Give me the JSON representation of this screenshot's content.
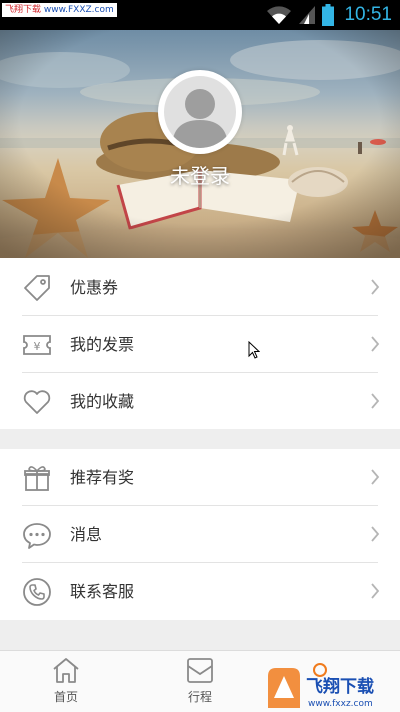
{
  "status_bar": {
    "watermark_label": "飞翔下载",
    "watermark_url": "www.FXXZ.com",
    "time": "10:51"
  },
  "header": {
    "login_text": "未登录"
  },
  "menu_group_1": [
    {
      "label": "优惠券",
      "icon": "coupon-icon"
    },
    {
      "label": "我的发票",
      "icon": "invoice-icon"
    },
    {
      "label": "我的收藏",
      "icon": "heart-icon"
    }
  ],
  "menu_group_2": [
    {
      "label": "推荐有奖",
      "icon": "gift-icon"
    },
    {
      "label": "消息",
      "icon": "message-icon"
    },
    {
      "label": "联系客服",
      "icon": "phone-icon"
    }
  ],
  "bottom_nav": [
    {
      "label": "首页",
      "icon": "home-icon"
    },
    {
      "label": "行程",
      "icon": "itinerary-icon"
    }
  ],
  "watermark_bottom": {
    "brand": "飞翔下载",
    "url": "www.fxxz.com"
  },
  "colors": {
    "time": "#33b5e5",
    "watermark_blue": "#1a4fb3",
    "watermark_orange": "#f07b1d",
    "divider": "#e3e3e3",
    "gap": "#eeeeee"
  }
}
